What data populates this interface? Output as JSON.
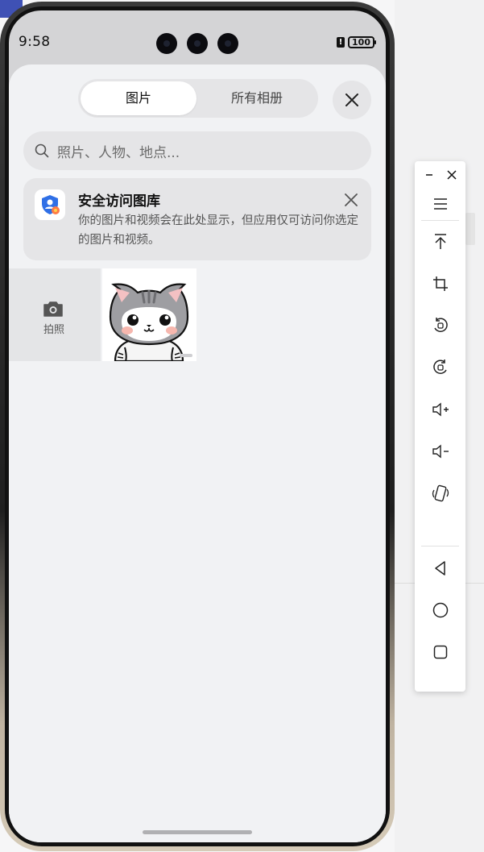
{
  "status_bar": {
    "time": "9:58",
    "battery": "100",
    "alert": "!"
  },
  "picker": {
    "tabs": [
      {
        "label": "图片",
        "active": true
      },
      {
        "label": "所有相册",
        "active": false
      }
    ],
    "search_placeholder": "照片、人物、地点...",
    "notice": {
      "title": "安全访问图库",
      "body": "你的图片和视频会在此处显示，但应用仅可访问你选定的图片和视频。"
    },
    "camera_tile_label": "拍照",
    "photo_count": 1
  },
  "toolbar": {
    "items": [
      "minimize-icon",
      "close-icon",
      "menu-icon",
      "pin-top-icon",
      "crop-icon",
      "rotate-left-icon",
      "rotate-right-icon",
      "volume-up-icon",
      "volume-down-icon",
      "shake-icon",
      "back-icon",
      "home-icon",
      "recents-icon"
    ]
  },
  "colors": {
    "sheet_bg": "#f1f2f4",
    "control_bg": "#e5e5e7",
    "accent_blue": "#2f6fe6"
  }
}
